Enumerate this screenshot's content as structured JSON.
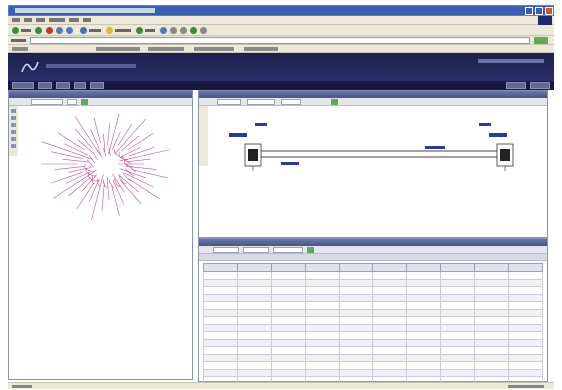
{
  "browser": {
    "title": "",
    "menus": [
      "File",
      "Edit",
      "View",
      "Favorites",
      "Tools",
      "Help"
    ],
    "toolbar_buttons": [
      "Back",
      "Forward",
      "Stop",
      "Refresh",
      "Home",
      "Search",
      "Favorites",
      "Media",
      "History"
    ],
    "address": "",
    "links": [
      "",
      "",
      "",
      "",
      ""
    ]
  },
  "app": {
    "nav": [
      "",
      "",
      "",
      "",
      ""
    ],
    "right_buttons": [
      "",
      ""
    ]
  },
  "map_panel": {
    "header": "",
    "toolbar_label": "",
    "select_value": ""
  },
  "route_panel": {
    "header": "",
    "cable_left": "",
    "cable_right": "",
    "node_left": "",
    "node_right": "",
    "span_left": "",
    "span_right": ""
  },
  "table_panel": {
    "header": "",
    "columns": [
      "",
      "",
      "",
      "",
      "",
      "",
      "",
      "",
      "",
      ""
    ],
    "rows": 15
  },
  "colors": {
    "app_header": "#1d1f4a",
    "panel_header": "#5a6696",
    "map_lines": "#c0509a",
    "link_text": "#7b2a5a",
    "route_line": "#444444",
    "node_fill": "#ffffff"
  }
}
